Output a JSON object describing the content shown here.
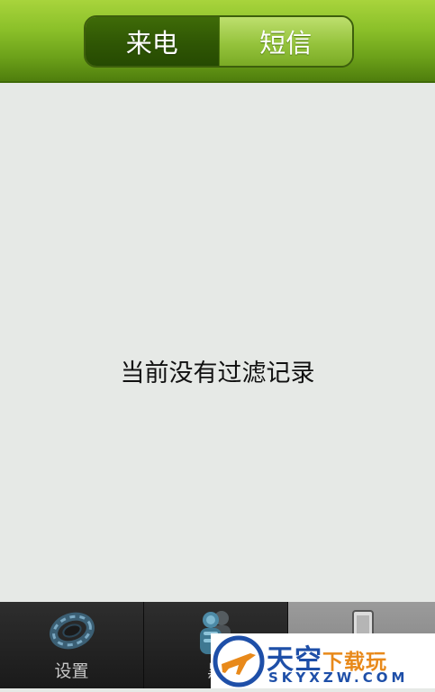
{
  "header": {
    "tabs": [
      {
        "label": "来电",
        "active": true
      },
      {
        "label": "短信",
        "active": false
      }
    ]
  },
  "main": {
    "empty_message": "当前没有过滤记录"
  },
  "bottom_nav": {
    "items": [
      {
        "label": "设置",
        "icon": "gear-icon"
      },
      {
        "label": "黑",
        "icon": "contacts-icon"
      },
      {
        "label": "",
        "icon": "phone-icon",
        "selected": true
      }
    ]
  },
  "watermark": {
    "main": "天空",
    "accent": "下载玩",
    "sub": "SKYXZW.COM"
  },
  "colors": {
    "header_green": "#8cc12a",
    "active_tab": "#2f5604",
    "background": "#e6e9e6",
    "nav_dark": "#1c1c1c",
    "nav_selected": "#8a8a8a",
    "watermark_blue": "#1e4fa8",
    "watermark_orange": "#e8891a"
  }
}
